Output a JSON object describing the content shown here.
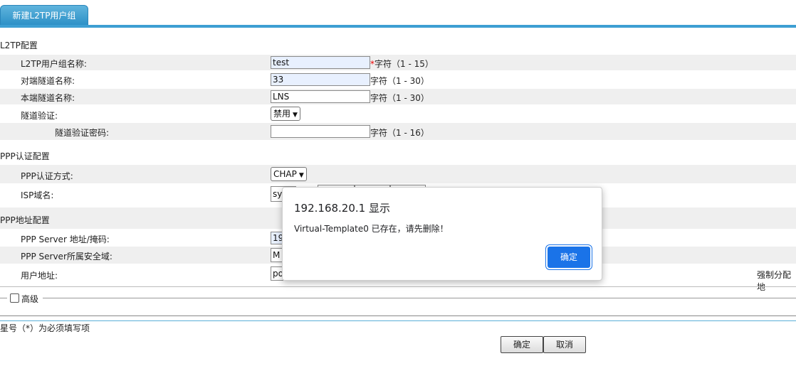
{
  "tab": {
    "label": "新建L2TP用户组"
  },
  "l2tp": {
    "section_title": "L2TP配置",
    "group_name": {
      "label": "L2TP用户组名称:",
      "value": "test",
      "required": "*",
      "hint": "字符（1 - 15）"
    },
    "peer_tunnel": {
      "label": "对端隧道名称:",
      "value": "33",
      "hint": "字符（1 - 30）"
    },
    "local_tunnel": {
      "label": "本端隧道名称:",
      "value": "LNS",
      "hint": "字符（1 - 30）"
    },
    "tunnel_auth": {
      "label": "隧道验证:",
      "value": "禁用"
    },
    "tunnel_password": {
      "label": "隧道验证密码:",
      "value": "",
      "hint": "字符（1 - 16）"
    }
  },
  "ppp_auth": {
    "section_title": "PPP认证配置",
    "method": {
      "label": "PPP认证方式:",
      "value": "CHAP"
    },
    "isp_domain": {
      "label": "ISP域名:",
      "value": "sy"
    }
  },
  "ppp_addr": {
    "section_title": "PPP地址配置",
    "server_addr": {
      "label": "PPP Server 地址/掩码:",
      "value": "19"
    },
    "server_zone": {
      "label": "PPP Server所属安全域:",
      "value": "M"
    },
    "user_addr": {
      "label": "用户地址:",
      "value": "po",
      "force_label": "强制分配地"
    }
  },
  "advanced": {
    "label": "高级"
  },
  "note": "星号（*）为必须填写项",
  "buttons": {
    "ok": "确定",
    "cancel": "取消"
  },
  "dialog": {
    "title": "192.168.20.1 显示",
    "message": "Virtual-Template0 已存在，请先删除！",
    "ok": "确定"
  },
  "colors": {
    "accent": "#3d9fd3",
    "dialog_button": "#1a73e8",
    "row_shade": "#efefef"
  }
}
